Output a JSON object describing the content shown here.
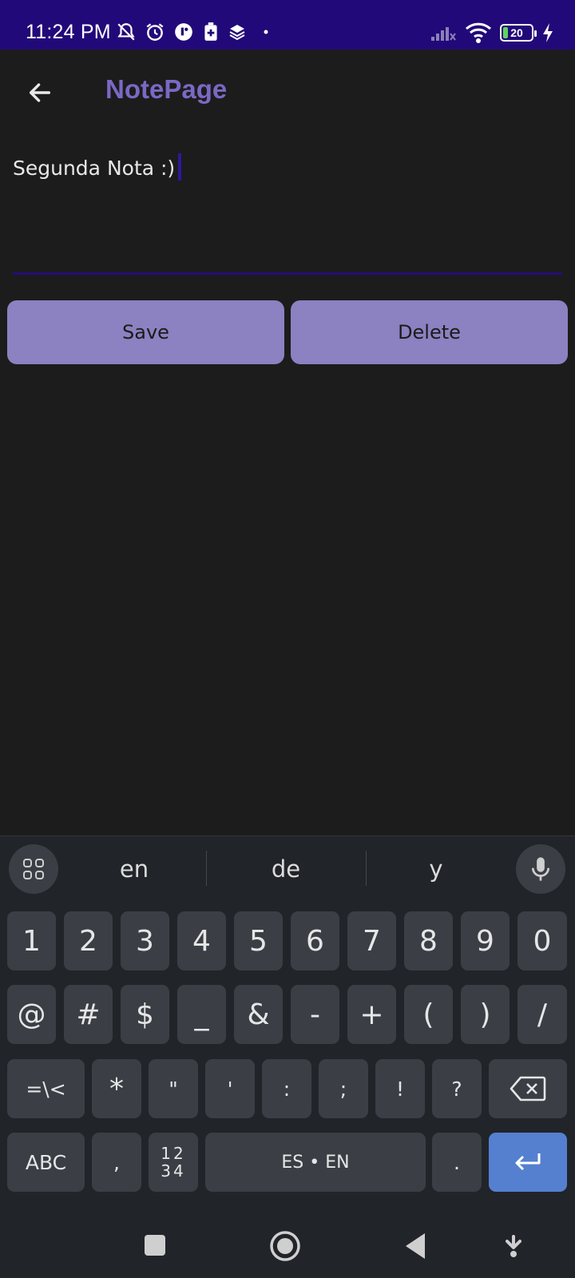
{
  "status_bar": {
    "time": "11:24 PM",
    "battery": "20",
    "icons": [
      "bell-off-icon",
      "alarm-icon",
      "app-icon",
      "battery-saver-icon",
      "layers-icon",
      "dot-icon",
      "signal-icon",
      "wifi-icon",
      "battery-icon",
      "charging-icon"
    ]
  },
  "app_bar": {
    "title": "NotePage",
    "back_icon": "arrow-left-icon"
  },
  "editor": {
    "text": "Segunda Nota :)"
  },
  "buttons": {
    "save": "Save",
    "delete": "Delete"
  },
  "keyboard": {
    "suggestions": [
      "en",
      "de",
      "y"
    ],
    "row1": [
      "1",
      "2",
      "3",
      "4",
      "5",
      "6",
      "7",
      "8",
      "9",
      "0"
    ],
    "row2": [
      "@",
      "#",
      "$",
      "_",
      "&",
      "-",
      "+",
      "(",
      ")",
      "/"
    ],
    "row3": [
      "=\\<",
      "*",
      "\"",
      "'",
      ":",
      ";",
      "!",
      "?"
    ],
    "row4": {
      "abc": "ABC",
      "comma": ",",
      "nums_top": "12",
      "nums_bottom": "34",
      "space": "ES • EN",
      "period": "."
    }
  },
  "colors": {
    "status_bar": "#22097a",
    "title": "#7b68c5",
    "button": "#8c81c1",
    "background": "#1c1c1c",
    "keyboard": "#212429",
    "enter_key": "#5580cf"
  }
}
